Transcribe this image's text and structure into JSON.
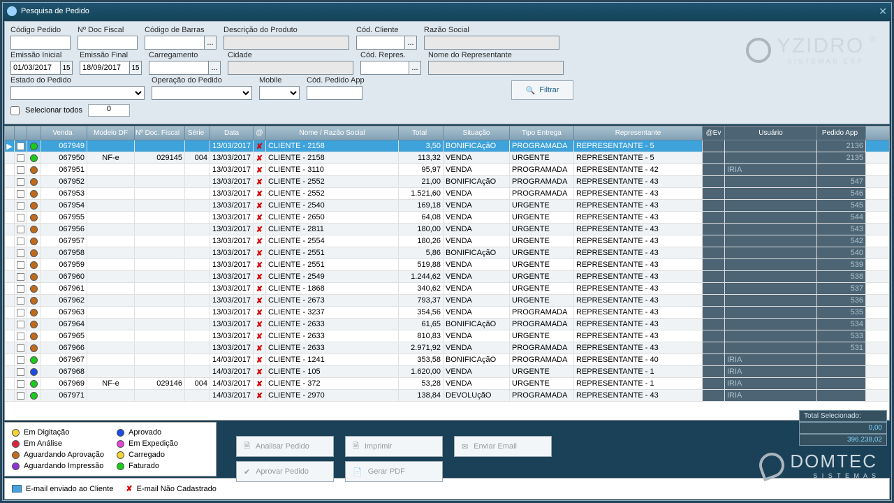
{
  "title": "Pesquisa de Pedido",
  "labels": {
    "codPedido": "Código Pedido",
    "docFiscal": "Nº Doc Fiscal",
    "codBarras": "Código de Barras",
    "descProd": "Descrição do Produto",
    "codCliente": "Cód. Cliente",
    "razao": "Razão Social",
    "emisIni": "Emissão Inicial",
    "emisFim": "Emissão Final",
    "carreg": "Carregamento",
    "cidade": "Cidade",
    "codRepres": "Cód. Repres.",
    "nomeRep": "Nome do Representante",
    "estadoPed": "Estado do Pedido",
    "operPed": "Operação do Pedido",
    "mobile": "Mobile",
    "codApp": "Cód. Pedido App",
    "filtrar": "Filtrar",
    "selTodos": "Selecionar todos"
  },
  "values": {
    "emisIni": "01/03/2017",
    "emisFim": "18/09/2017",
    "count": "0"
  },
  "columns": [
    "",
    "",
    "",
    "Venda",
    "Modelo DF",
    "Nº Doc. Fiscal",
    "Série",
    "Data",
    "@",
    "Nome / Razão Social",
    "Total",
    "Situação",
    "Tipo Entrega",
    "Representante",
    "@Ev",
    "Usuário",
    "Pedido App"
  ],
  "rows": [
    {
      "sel": true,
      "color": "#19cc19",
      "venda": "067949",
      "mod": "",
      "doc": "",
      "ser": "",
      "data": "13/03/2017",
      "nome": "CLIENTE - 2158",
      "total": "3,50",
      "sit": "BONIFICAçãO",
      "tipo": "PROGRAMADA",
      "rep": "REPRESENTANTE - 5",
      "usr": "",
      "app": "2136"
    },
    {
      "color": "#19cc19",
      "venda": "067950",
      "mod": "NF-e",
      "doc": "029145",
      "ser": "004",
      "data": "13/03/2017",
      "nome": "CLIENTE - 2158",
      "total": "113,32",
      "sit": "VENDA",
      "tipo": "URGENTE",
      "rep": "REPRESENTANTE - 5",
      "usr": "",
      "app": "2135"
    },
    {
      "color": "#c26a1a",
      "venda": "067951",
      "mod": "",
      "doc": "",
      "ser": "",
      "data": "13/03/2017",
      "nome": "CLIENTE - 3110",
      "total": "95,97",
      "sit": "VENDA",
      "tipo": "PROGRAMADA",
      "rep": "REPRESENTANTE - 42",
      "usr": "IRIA",
      "app": ""
    },
    {
      "color": "#c26a1a",
      "venda": "067952",
      "mod": "",
      "doc": "",
      "ser": "",
      "data": "13/03/2017",
      "nome": "CLIENTE - 2552",
      "total": "21,00",
      "sit": "BONIFICAçãO",
      "tipo": "PROGRAMADA",
      "rep": "REPRESENTANTE - 43",
      "usr": "",
      "app": "547"
    },
    {
      "color": "#c26a1a",
      "venda": "067953",
      "mod": "",
      "doc": "",
      "ser": "",
      "data": "13/03/2017",
      "nome": "CLIENTE - 2552",
      "total": "1.521,60",
      "sit": "VENDA",
      "tipo": "PROGRAMADA",
      "rep": "REPRESENTANTE - 43",
      "usr": "",
      "app": "546"
    },
    {
      "color": "#c26a1a",
      "venda": "067954",
      "mod": "",
      "doc": "",
      "ser": "",
      "data": "13/03/2017",
      "nome": "CLIENTE - 2540",
      "total": "169,18",
      "sit": "VENDA",
      "tipo": "URGENTE",
      "rep": "REPRESENTANTE - 43",
      "usr": "",
      "app": "545"
    },
    {
      "color": "#c26a1a",
      "venda": "067955",
      "mod": "",
      "doc": "",
      "ser": "",
      "data": "13/03/2017",
      "nome": "CLIENTE - 2650",
      "total": "64,08",
      "sit": "VENDA",
      "tipo": "URGENTE",
      "rep": "REPRESENTANTE - 43",
      "usr": "",
      "app": "544"
    },
    {
      "color": "#c26a1a",
      "venda": "067956",
      "mod": "",
      "doc": "",
      "ser": "",
      "data": "13/03/2017",
      "nome": "CLIENTE - 2811",
      "total": "180,00",
      "sit": "VENDA",
      "tipo": "URGENTE",
      "rep": "REPRESENTANTE - 43",
      "usr": "",
      "app": "543"
    },
    {
      "color": "#c26a1a",
      "venda": "067957",
      "mod": "",
      "doc": "",
      "ser": "",
      "data": "13/03/2017",
      "nome": "CLIENTE - 2554",
      "total": "180,26",
      "sit": "VENDA",
      "tipo": "URGENTE",
      "rep": "REPRESENTANTE - 43",
      "usr": "",
      "app": "542"
    },
    {
      "color": "#c26a1a",
      "venda": "067958",
      "mod": "",
      "doc": "",
      "ser": "",
      "data": "13/03/2017",
      "nome": "CLIENTE - 2551",
      "total": "5,86",
      "sit": "BONIFICAçãO",
      "tipo": "URGENTE",
      "rep": "REPRESENTANTE - 43",
      "usr": "",
      "app": "540"
    },
    {
      "color": "#c26a1a",
      "venda": "067959",
      "mod": "",
      "doc": "",
      "ser": "",
      "data": "13/03/2017",
      "nome": "CLIENTE - 2551",
      "total": "519,88",
      "sit": "VENDA",
      "tipo": "URGENTE",
      "rep": "REPRESENTANTE - 43",
      "usr": "",
      "app": "539"
    },
    {
      "color": "#c26a1a",
      "venda": "067960",
      "mod": "",
      "doc": "",
      "ser": "",
      "data": "13/03/2017",
      "nome": "CLIENTE - 2549",
      "total": "1.244,62",
      "sit": "VENDA",
      "tipo": "URGENTE",
      "rep": "REPRESENTANTE - 43",
      "usr": "",
      "app": "538"
    },
    {
      "color": "#c26a1a",
      "venda": "067961",
      "mod": "",
      "doc": "",
      "ser": "",
      "data": "13/03/2017",
      "nome": "CLIENTE - 1868",
      "total": "340,62",
      "sit": "VENDA",
      "tipo": "URGENTE",
      "rep": "REPRESENTANTE - 43",
      "usr": "",
      "app": "537"
    },
    {
      "color": "#c26a1a",
      "venda": "067962",
      "mod": "",
      "doc": "",
      "ser": "",
      "data": "13/03/2017",
      "nome": "CLIENTE - 2673",
      "total": "793,37",
      "sit": "VENDA",
      "tipo": "URGENTE",
      "rep": "REPRESENTANTE - 43",
      "usr": "",
      "app": "536"
    },
    {
      "color": "#c26a1a",
      "venda": "067963",
      "mod": "",
      "doc": "",
      "ser": "",
      "data": "13/03/2017",
      "nome": "CLIENTE - 3237",
      "total": "354,56",
      "sit": "VENDA",
      "tipo": "PROGRAMADA",
      "rep": "REPRESENTANTE - 43",
      "usr": "",
      "app": "535"
    },
    {
      "color": "#c26a1a",
      "venda": "067964",
      "mod": "",
      "doc": "",
      "ser": "",
      "data": "13/03/2017",
      "nome": "CLIENTE - 2633",
      "total": "61,65",
      "sit": "BONIFICAçãO",
      "tipo": "PROGRAMADA",
      "rep": "REPRESENTANTE - 43",
      "usr": "",
      "app": "534"
    },
    {
      "color": "#c26a1a",
      "venda": "067965",
      "mod": "",
      "doc": "",
      "ser": "",
      "data": "13/03/2017",
      "nome": "CLIENTE - 2633",
      "total": "810,83",
      "sit": "VENDA",
      "tipo": "URGENTE",
      "rep": "REPRESENTANTE - 43",
      "usr": "",
      "app": "533"
    },
    {
      "color": "#c26a1a",
      "venda": "067966",
      "mod": "",
      "doc": "",
      "ser": "",
      "data": "13/03/2017",
      "nome": "CLIENTE - 2633",
      "total": "2.971,92",
      "sit": "VENDA",
      "tipo": "PROGRAMADA",
      "rep": "REPRESENTANTE - 43",
      "usr": "",
      "app": "531"
    },
    {
      "color": "#19cc19",
      "venda": "067967",
      "mod": "",
      "doc": "",
      "ser": "",
      "data": "14/03/2017",
      "nome": "CLIENTE - 1241",
      "total": "353,58",
      "sit": "BONIFICAçãO",
      "tipo": "PROGRAMADA",
      "rep": "REPRESENTANTE - 40",
      "usr": "IRIA",
      "app": ""
    },
    {
      "color": "#1a4de8",
      "venda": "067968",
      "mod": "",
      "doc": "",
      "ser": "",
      "data": "14/03/2017",
      "nome": "CLIENTE - 105",
      "total": "1.620,00",
      "sit": "VENDA",
      "tipo": "URGENTE",
      "rep": "REPRESENTANTE - 1",
      "usr": "IRIA",
      "app": ""
    },
    {
      "color": "#19cc19",
      "venda": "067969",
      "mod": "NF-e",
      "doc": "029146",
      "ser": "004",
      "data": "14/03/2017",
      "nome": "CLIENTE - 372",
      "total": "53,28",
      "sit": "VENDA",
      "tipo": "URGENTE",
      "rep": "REPRESENTANTE - 1",
      "usr": "IRIA",
      "app": ""
    },
    {
      "color": "#19cc19",
      "venda": "067971",
      "mod": "",
      "doc": "",
      "ser": "",
      "data": "14/03/2017",
      "nome": "CLIENTE - 2970",
      "total": "138,84",
      "sit": "DEVOLUçãO",
      "tipo": "PROGRAMADA",
      "rep": "REPRESENTANTE - 43",
      "usr": "IRIA",
      "app": ""
    }
  ],
  "legend": [
    {
      "c": "#f3d233",
      "t": "Em Digitação"
    },
    {
      "c": "#1a4de8",
      "t": "Aprovado"
    },
    {
      "c": "#e2243b",
      "t": "Em Análise"
    },
    {
      "c": "#e047d0",
      "t": "Em Expedição"
    },
    {
      "c": "#c26a1a",
      "t": "Aguardando Aprovação"
    },
    {
      "c": "#f3d233",
      "t": "Carregado"
    },
    {
      "c": "#9033d8",
      "t": "Aguardando Impressão"
    },
    {
      "c": "#19cc19",
      "t": "Faturado"
    }
  ],
  "emailLegend": {
    "sent": "E-mail enviado ao Cliente",
    "none": "E-mail Não Cadastrado"
  },
  "actions": {
    "analisar": "Analisar Pedido",
    "imprimir": "Imprimir",
    "email": "Enviar Email",
    "aprovar": "Aprovar Pedido",
    "pdf": "Gerar PDF"
  },
  "totals": {
    "label": "Total Selecionado:",
    "val1": "0,00",
    "val2": "396.238,02"
  },
  "brands": {
    "b1": "YZIDRO",
    "b1sub": "SISTEMAS ERP",
    "b2": "DOMTEC",
    "b2sub": "S I S T E M A S"
  }
}
